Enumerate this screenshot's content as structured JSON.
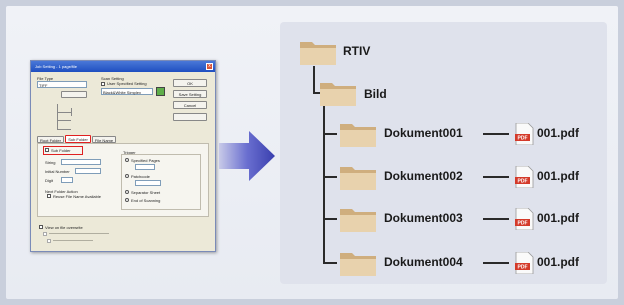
{
  "dialog": {
    "title": "Job Setting - 1 page/file",
    "close_glyph": "x",
    "file_type_label": "File Type",
    "file_type_value": "TIFF",
    "scan_setting_label": "Scan Setting",
    "user_specified_label": "User Specified Setting",
    "scan_value": "Black&White Simplex",
    "ok_label": "OK",
    "save_label": "Save Setting",
    "cancel_label": "Cancel",
    "tab_root": "Root Folder",
    "tab_sub": "Sub Folder",
    "tab_filename": "File Name",
    "sub_folder_check": "Sub Folder",
    "string_label": "String",
    "initial_number_label": "Initial Number",
    "digit_label": "Digit",
    "trigger_label": "Trigger",
    "specified_pages_label": "Specified Pages",
    "patchcode_label": "Patchcode",
    "separator_sheet_label": "Separator Sheet",
    "end_scanning_label": "End of Scanning",
    "next_folder_label": "Next Folder Action",
    "reuse_label": "Reuse File Name Available",
    "view_scanner_label": "View on file overwrite"
  },
  "tree": {
    "root": "RTIV",
    "sub": "Bild",
    "documents": [
      {
        "folder": "Dokument001",
        "file": "001.pdf"
      },
      {
        "folder": "Dokument002",
        "file": "001.pdf"
      },
      {
        "folder": "Dokument003",
        "file": "001.pdf"
      },
      {
        "folder": "Dokument004",
        "file": "001.pdf"
      }
    ],
    "pdf_badge": "PDF"
  },
  "colors": {
    "folder": "#e2c9a0",
    "arrow": "#4a4fb8",
    "pdf_red": "#d43a2a"
  }
}
